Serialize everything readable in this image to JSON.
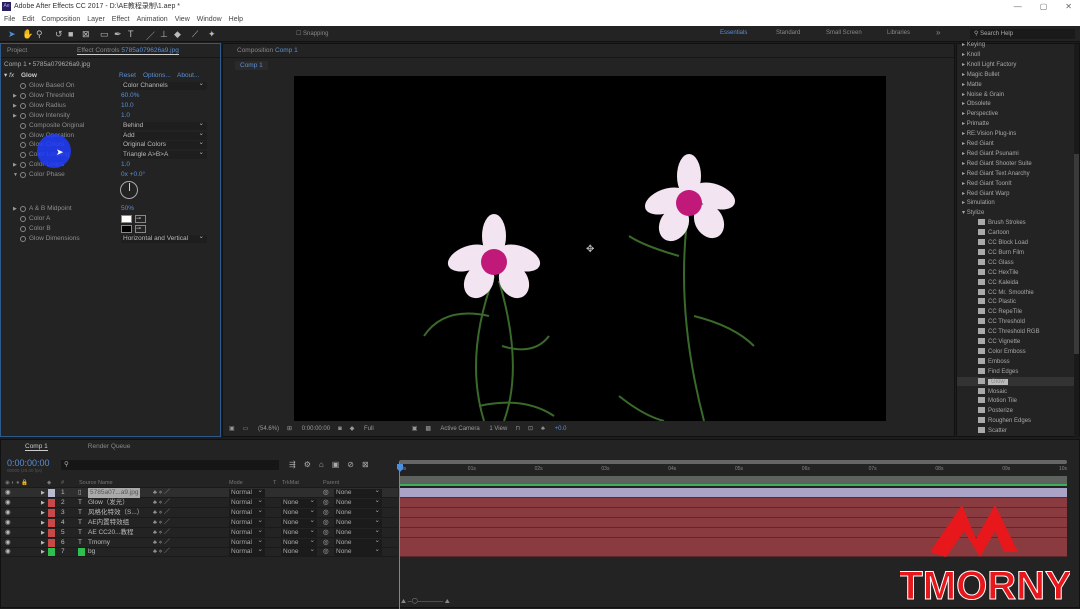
{
  "titlebar": {
    "title": "Adobe After Effects CC 2017 - D:\\AE教程录制\\1.aep *",
    "app_icon": "Ae",
    "controls": [
      "minimize-icon",
      "maximize-icon",
      "close-icon"
    ]
  },
  "menu": [
    "File",
    "Edit",
    "Composition",
    "Layer",
    "Effect",
    "Animation",
    "View",
    "Window",
    "Help"
  ],
  "toolbar": {
    "snapping": "Snapping",
    "workspaces": [
      "Essentials",
      "Standard",
      "Small Screen",
      "Libraries"
    ],
    "search_placeholder": "Search Help"
  },
  "left_panel": {
    "tab_project": "Project",
    "tab_effect_prefix": "Effect Controls",
    "tab_effect_file": "5785a079626a9.jpg",
    "breadcrumb": "Comp 1 • 5785a079626a9.jpg",
    "effect": "Glow",
    "reset": "Reset",
    "options": "Options...",
    "about": "About...",
    "props": [
      {
        "name": "Glow Based On",
        "dropdown": "Color Channels"
      },
      {
        "name": "Glow Threshold",
        "value": "60.0%",
        "arrow": true
      },
      {
        "name": "Glow Radius",
        "value": "10.0",
        "arrow": true
      },
      {
        "name": "Glow Intensity",
        "value": "1.0",
        "arrow": true
      },
      {
        "name": "Composite Original",
        "dropdown": "Behind"
      },
      {
        "name": "Glow Operation",
        "dropdown": "Add"
      },
      {
        "name": "Glow Colors",
        "dropdown": "Original Colors"
      },
      {
        "name": "Color Looping",
        "dropdown": "Triangle A>B>A"
      },
      {
        "name": "Color Loops",
        "value": "1.0",
        "arrow": true
      },
      {
        "name": "Color Phase",
        "value": "0x +0.0°",
        "arrow": true,
        "open": true
      }
    ],
    "props2": [
      {
        "name": "A & B Midpoint",
        "value": "50%",
        "arrow": true
      },
      {
        "name": "Color A",
        "color": "#ffffff"
      },
      {
        "name": "Color B",
        "color": "#000000"
      },
      {
        "name": "Glow Dimensions",
        "dropdown": "Horizontal and Vertical"
      }
    ]
  },
  "viewer": {
    "tab_prefix": "Composition",
    "tab_comp": "Comp 1",
    "subtab": "Comp 1",
    "zoom": "(54.6%)",
    "timecode": "0:00:00:00",
    "resolution": "Full",
    "camera": "Active Camera",
    "views": "1 View",
    "exposure": "+0.0"
  },
  "effects_panel": {
    "items": [
      {
        "label": "Keying",
        "type": "cat"
      },
      {
        "label": "Knoll",
        "type": "cat"
      },
      {
        "label": "Knoll Light Factory",
        "type": "cat"
      },
      {
        "label": "Magic Bullet",
        "type": "cat"
      },
      {
        "label": "Matte",
        "type": "cat"
      },
      {
        "label": "Noise & Grain",
        "type": "cat"
      },
      {
        "label": "Obsolete",
        "type": "cat"
      },
      {
        "label": "Perspective",
        "type": "cat"
      },
      {
        "label": "Primatte",
        "type": "cat"
      },
      {
        "label": "RE:Vision Plug-ins",
        "type": "cat"
      },
      {
        "label": "Red Giant",
        "type": "cat"
      },
      {
        "label": "Red Giant Psunami",
        "type": "cat"
      },
      {
        "label": "Red Giant Shooter Suite",
        "type": "cat"
      },
      {
        "label": "Red Giant Text Anarchy",
        "type": "cat"
      },
      {
        "label": "Red Giant ToonIt",
        "type": "cat"
      },
      {
        "label": "Red Giant Warp",
        "type": "cat"
      },
      {
        "label": "Simulation",
        "type": "cat"
      },
      {
        "label": "Stylize",
        "type": "open"
      },
      {
        "label": "Brush Strokes"
      },
      {
        "label": "Cartoon"
      },
      {
        "label": "CC Block Load"
      },
      {
        "label": "CC Burn Film"
      },
      {
        "label": "CC Glass"
      },
      {
        "label": "CC HexTile"
      },
      {
        "label": "CC Kaleida"
      },
      {
        "label": "CC Mr. Smoothie"
      },
      {
        "label": "CC Plastic"
      },
      {
        "label": "CC RepeTile"
      },
      {
        "label": "CC Threshold"
      },
      {
        "label": "CC Threshold RGB"
      },
      {
        "label": "CC Vignette"
      },
      {
        "label": "Color Emboss"
      },
      {
        "label": "Emboss"
      },
      {
        "label": "Find Edges"
      },
      {
        "label": "Glow",
        "selected": true
      },
      {
        "label": "Mosaic"
      },
      {
        "label": "Motion Tile"
      },
      {
        "label": "Posterize"
      },
      {
        "label": "Roughen Edges"
      },
      {
        "label": "Scatter"
      }
    ]
  },
  "timeline": {
    "tab": "Comp 1",
    "render_queue": "Render Queue",
    "timecode": "0:00:00:00",
    "fps": "00000 (25.00 fps)",
    "headers": {
      "source": "Source Name",
      "mode": "Mode",
      "t": "T",
      "trkmat": "TrkMat",
      "parent": "Parent"
    },
    "ruler": [
      "0s",
      "01s",
      "02s",
      "03s",
      "04s",
      "05s",
      "06s",
      "07s",
      "08s",
      "09s",
      "10s"
    ],
    "layers": [
      {
        "num": "1",
        "type": "img",
        "name": "5785a07...a9.jpg",
        "mode": "Normal",
        "trkmat": "",
        "parent": "None",
        "color": "#b9b9d0",
        "selected": true
      },
      {
        "num": "2",
        "type": "T",
        "name": "Glow（发光）",
        "mode": "Normal",
        "trkmat": "None",
        "parent": "None",
        "color": "#c94848"
      },
      {
        "num": "3",
        "type": "T",
        "name": "风格化特效（S...）",
        "mode": "Normal",
        "trkmat": "None",
        "parent": "None",
        "color": "#c94848"
      },
      {
        "num": "4",
        "type": "T",
        "name": "AE内置特效组",
        "mode": "Normal",
        "trkmat": "None",
        "parent": "None",
        "color": "#c94848"
      },
      {
        "num": "5",
        "type": "T",
        "name": "AE  CC20...教程",
        "mode": "Normal",
        "trkmat": "None",
        "parent": "None",
        "color": "#c94848"
      },
      {
        "num": "6",
        "type": "T",
        "name": "Tmorny",
        "mode": "Normal",
        "trkmat": "None",
        "parent": "None",
        "color": "#c94848"
      },
      {
        "num": "7",
        "type": "solid",
        "name": "bg",
        "mode": "Normal",
        "trkmat": "None",
        "parent": "None",
        "color": "#2fbf4f"
      }
    ]
  },
  "watermark": "TMORNY",
  "colors": {
    "accent": "#5b8fd6",
    "layer_bar": "#8a3b40",
    "selected_bar": "#aaa4c6",
    "watermark": "#e8171b"
  }
}
